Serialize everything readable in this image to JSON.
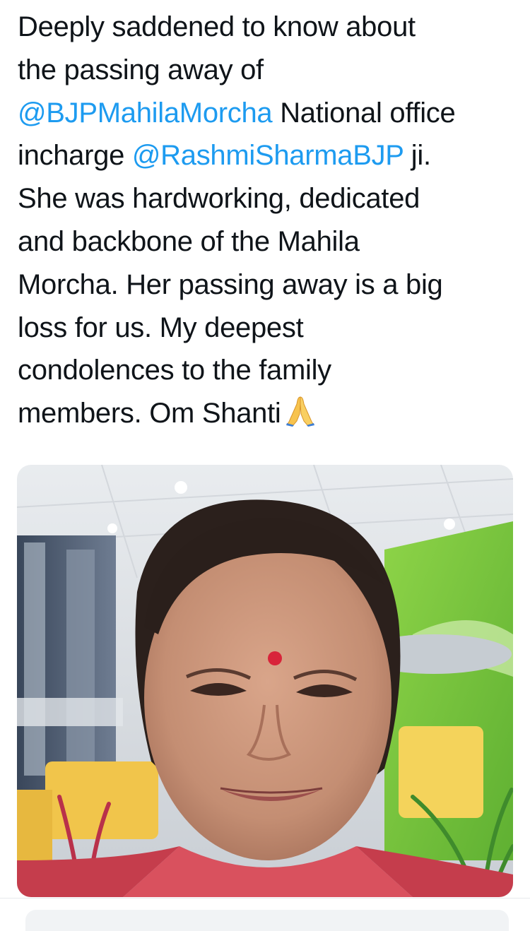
{
  "tweet": {
    "lines": [
      {
        "parts": [
          {
            "text": "Deeply saddened to know about",
            "type": "text"
          }
        ]
      },
      {
        "parts": [
          {
            "text": "the passing away of",
            "type": "text"
          }
        ]
      },
      {
        "parts": [
          {
            "text": "@BJPMahilaMorcha",
            "type": "mention"
          },
          {
            "text": " National office",
            "type": "text"
          }
        ]
      },
      {
        "parts": [
          {
            "text": "incharge ",
            "type": "text"
          },
          {
            "text": "@RashmiSharmaBJP",
            "type": "mention"
          },
          {
            "text": " ji.",
            "type": "text"
          }
        ]
      },
      {
        "parts": [
          {
            "text": "She was hardworking, dedicated",
            "type": "text"
          }
        ]
      },
      {
        "parts": [
          {
            "text": "and backbone of the Mahila",
            "type": "text"
          }
        ]
      },
      {
        "parts": [
          {
            "text": "Morcha. Her passing away is a big",
            "type": "text"
          }
        ]
      },
      {
        "parts": [
          {
            "text": "loss for us. My deepest",
            "type": "text"
          }
        ]
      },
      {
        "parts": [
          {
            "text": "condolences to the family",
            "type": "text"
          }
        ]
      },
      {
        "parts": [
          {
            "text": "members. Om Shanti",
            "type": "text"
          }
        ]
      }
    ],
    "emoji": "folded-hands-icon",
    "mention_color": "#1d9bf0",
    "text_color": "#0f1419"
  },
  "media": {
    "type": "photo"
  }
}
